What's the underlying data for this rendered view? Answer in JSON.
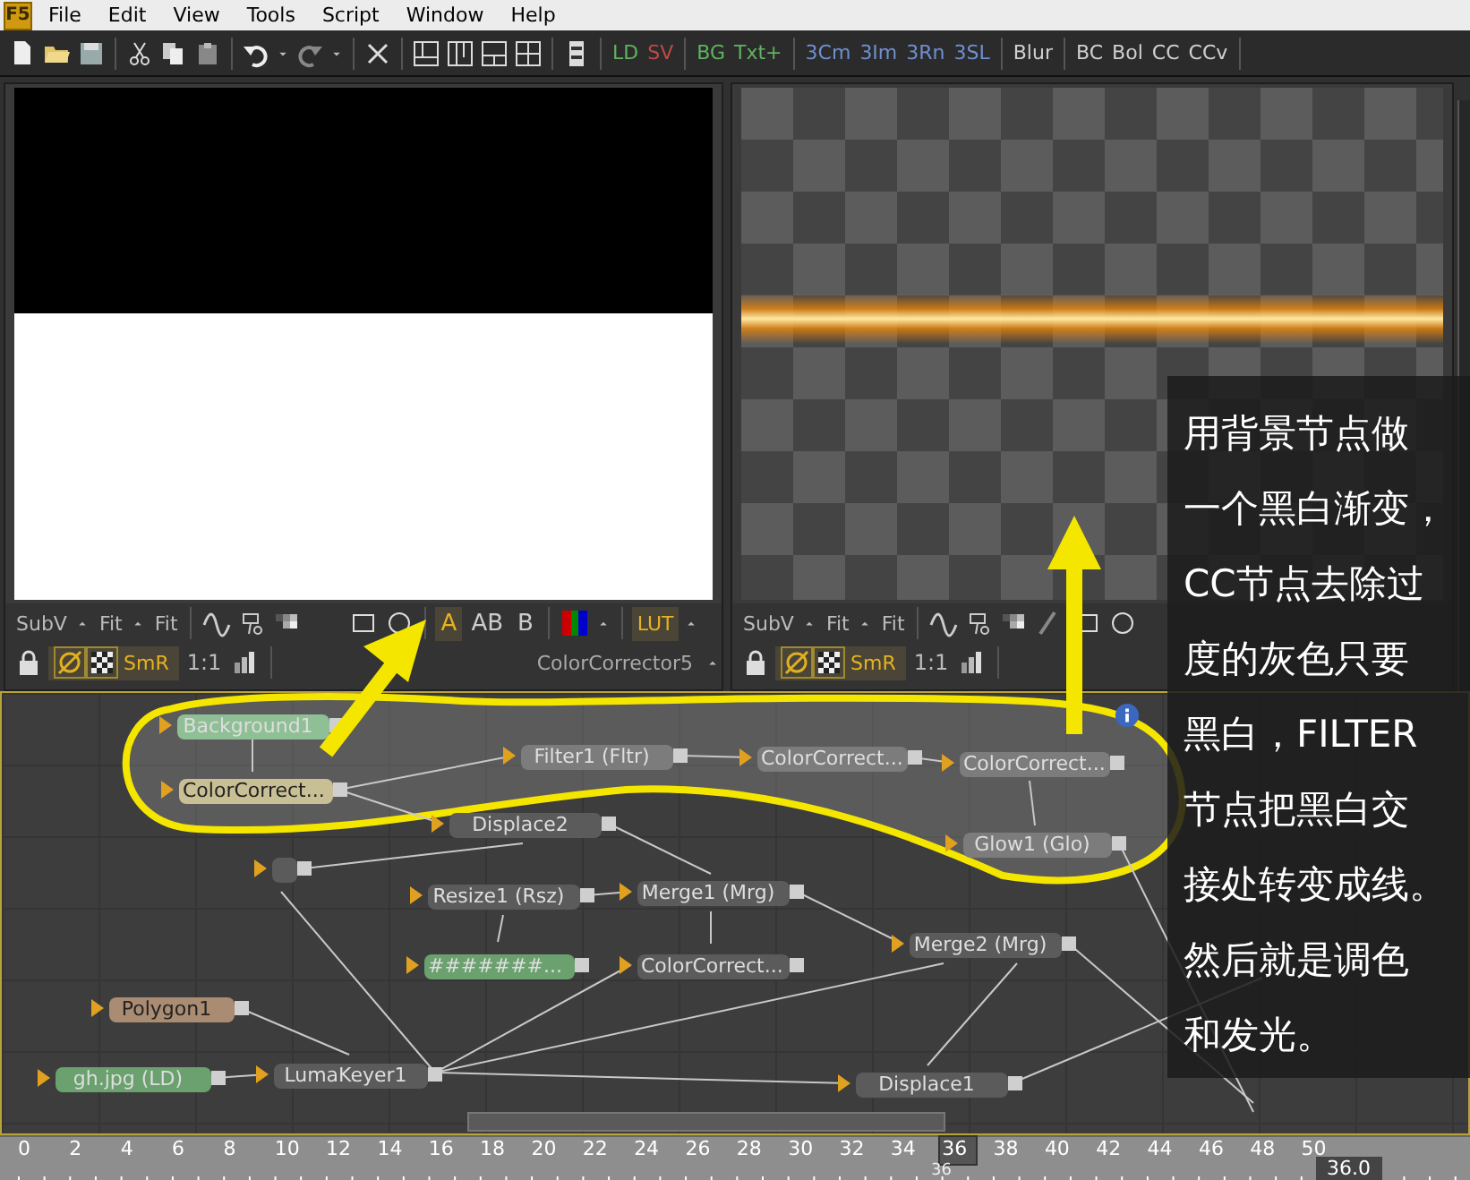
{
  "app": {
    "logo": "F5"
  },
  "menu": [
    "File",
    "Edit",
    "View",
    "Tools",
    "Script",
    "Window",
    "Help"
  ],
  "tool_buttons": [
    {
      "label": "LD",
      "color": "#5fb35f"
    },
    {
      "label": "SV",
      "color": "#c04848"
    },
    {
      "label": "BG",
      "color": "#5fb35f"
    },
    {
      "label": "Txt+",
      "color": "#5fb35f"
    },
    {
      "label": "3Cm",
      "color": "#6f8fd0"
    },
    {
      "label": "3Im",
      "color": "#6f8fd0"
    },
    {
      "label": "3Rn",
      "color": "#6f8fd0"
    },
    {
      "label": "3SL",
      "color": "#6f8fd0"
    },
    {
      "label": "Blur",
      "color": "#d0d0d0"
    },
    {
      "label": "BC",
      "color": "#d0d0d0"
    },
    {
      "label": "Bol",
      "color": "#d0d0d0"
    },
    {
      "label": "CC",
      "color": "#d0d0d0"
    },
    {
      "label": "CCv",
      "color": "#d0d0d0"
    }
  ],
  "viewers": [
    {
      "kind": "gradient",
      "toolbar": {
        "subview": "SubV",
        "fit": [
          "Fit",
          "Fit"
        ],
        "channels": [
          {
            "label": "A",
            "selected": true
          },
          {
            "label": "AB",
            "selected": false
          },
          {
            "label": "B",
            "selected": false
          }
        ],
        "lut": {
          "label": "LUT",
          "selected": true
        },
        "smr": "SmR",
        "scale": "1:1",
        "node_label": "ColorCorrector5"
      }
    },
    {
      "kind": "checker-glow",
      "toolbar": {
        "subview": "SubV",
        "fit": [
          "Fit",
          "Fit"
        ],
        "smr": "SmR",
        "scale": "1:1"
      }
    }
  ],
  "flow": {
    "nodes": [
      {
        "label": "Background1",
        "color": "#8fbf95"
      },
      {
        "label": "ColorCorrect...",
        "color": "#c9bf95"
      },
      {
        "label": "Filter1  (Fltr)",
        "color": "#7c7c7c"
      },
      {
        "label": "ColorCorrect...",
        "color": "#7c7c7c"
      },
      {
        "label": "ColorCorrect...",
        "color": "#7c7c7c"
      },
      {
        "label": "Glow1  (Glo)",
        "color": "#7c7c7c"
      },
      {
        "label": "Displace2",
        "color": "#5b5b5b"
      },
      {
        "label": "Resize1  (Rsz)",
        "color": "#5b5b5b"
      },
      {
        "label": "Merge1  (Mrg)",
        "color": "#5b5b5b"
      },
      {
        "label": "#######...",
        "color": "#6aa16e"
      },
      {
        "label": "ColorCorrect...",
        "color": "#5b5b5b"
      },
      {
        "label": "Merge2  (Mrg)",
        "color": "#5b5b5b"
      },
      {
        "label": "Polygon1",
        "color": "#a98c72"
      },
      {
        "label": "gh.jpg  (LD)",
        "color": "#6aa16e"
      },
      {
        "label": "LumaKeyer1",
        "color": "#5b5b5b"
      },
      {
        "label": "Displace1",
        "color": "#5b5b5b"
      },
      {
        "color": "#5b5b5b"
      }
    ]
  },
  "annotation": {
    "lines": [
      "用背景节点做",
      "一个黑白渐变，",
      "CC节点去除过",
      "度的灰色只要",
      "黑白，FILTER",
      "节点把黑白交",
      "接处转变成线。",
      "然后就是调色",
      "和发光。"
    ]
  },
  "ruler": {
    "marks": [
      {
        "text": "0",
        "selected": false
      },
      {
        "text": "2",
        "selected": false
      },
      {
        "text": "4",
        "selected": false
      },
      {
        "text": "6",
        "selected": false
      },
      {
        "text": "8",
        "selected": false
      },
      {
        "text": "10",
        "selected": false
      },
      {
        "text": "12",
        "selected": false
      },
      {
        "text": "14",
        "selected": false
      },
      {
        "text": "16",
        "selected": false
      },
      {
        "text": "18",
        "selected": false
      },
      {
        "text": "20",
        "selected": false
      },
      {
        "text": "22",
        "selected": false
      },
      {
        "text": "24",
        "selected": false
      },
      {
        "text": "26",
        "selected": false
      },
      {
        "text": "28",
        "selected": false
      },
      {
        "text": "30",
        "selected": false
      },
      {
        "text": "32",
        "selected": false
      },
      {
        "text": "34",
        "selected": false
      },
      {
        "text": "36",
        "selected": true
      },
      {
        "text": "38",
        "selected": false
      },
      {
        "text": "40",
        "selected": false
      },
      {
        "text": "42",
        "selected": false
      },
      {
        "text": "44",
        "selected": false
      },
      {
        "text": "46",
        "selected": false
      },
      {
        "text": "48",
        "selected": false
      },
      {
        "text": "50",
        "selected": false
      }
    ],
    "current": "36",
    "time": "36.0"
  }
}
